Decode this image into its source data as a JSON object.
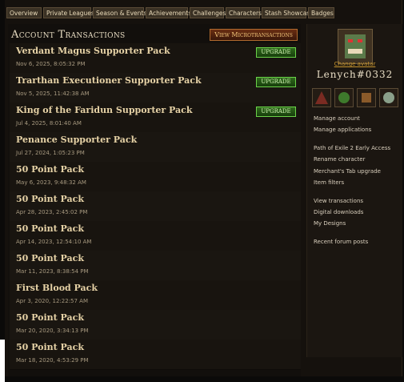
{
  "nav": [
    "Overview",
    "Private Leagues",
    "Season & Events",
    "Achievements",
    "Challenges",
    "Characters",
    "Stash Showcase",
    "Badges"
  ],
  "heading": "Account Transactions",
  "micro_button": "View Microtransactions",
  "upgrade_label": "UPGRADE",
  "transactions": [
    {
      "title": "Verdant Magus Supporter Pack",
      "date": "Nov 6, 2025, 8:05:32 PM",
      "upgrade": true
    },
    {
      "title": "Trarthan Executioner Supporter Pack",
      "date": "Nov 5, 2025, 11:42:38 AM",
      "upgrade": true
    },
    {
      "title": "King of the Faridun Supporter Pack",
      "date": "Jul 4, 2025, 8:01:40 AM",
      "upgrade": true
    },
    {
      "title": "Penance Supporter Pack",
      "date": "Jul 27, 2024, 1:05:23 PM",
      "upgrade": false
    },
    {
      "title": "50 Point Pack",
      "date": "May 6, 2023, 9:48:32 AM",
      "upgrade": false
    },
    {
      "title": "50 Point Pack",
      "date": "Apr 28, 2023, 2:45:02 PM",
      "upgrade": false
    },
    {
      "title": "50 Point Pack",
      "date": "Apr 14, 2023, 12:54:10 AM",
      "upgrade": false
    },
    {
      "title": "50 Point Pack",
      "date": "Mar 11, 2023, 8:38:54 PM",
      "upgrade": false
    },
    {
      "title": "First Blood Pack",
      "date": "Apr 3, 2020, 12:22:57 AM",
      "upgrade": false
    },
    {
      "title": "50 Point Pack",
      "date": "Mar 20, 2020, 3:34:13 PM",
      "upgrade": false
    },
    {
      "title": "50 Point Pack",
      "date": "Mar 18, 2020, 4:53:29 PM",
      "upgrade": false
    }
  ],
  "sidebar": {
    "change_avatar": "Change avatar",
    "account_name": "Lenych#0332",
    "links": [
      "Manage account",
      "Manage applications",
      "Path of Exile 2 Early Access",
      "Rename character",
      "Merchant's Tab upgrade",
      "Item filters",
      "View transactions",
      "Digital downloads",
      "My Designs",
      "Recent forum posts"
    ]
  },
  "colors": {
    "accent": "#c8962e",
    "upgrade": "#6bd24a"
  }
}
